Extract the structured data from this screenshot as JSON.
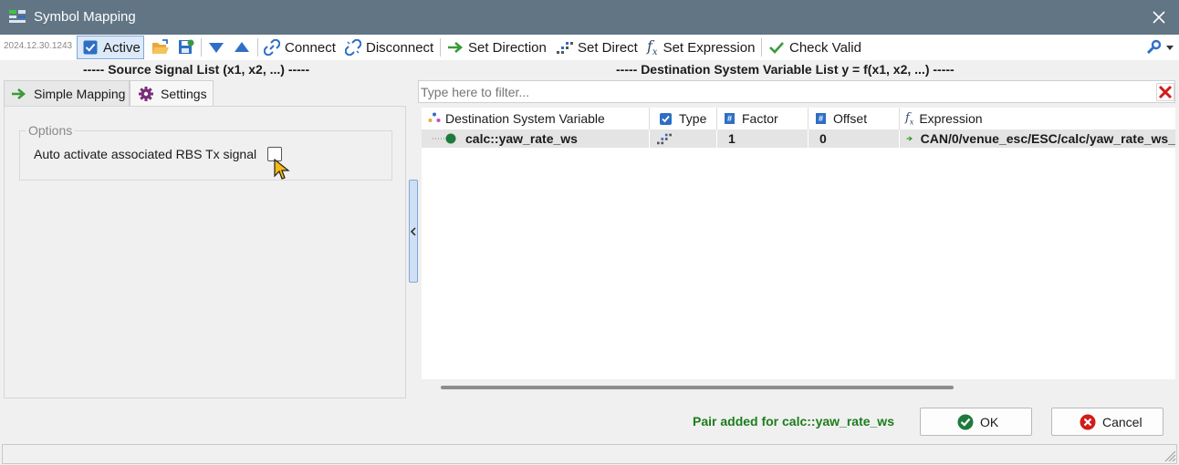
{
  "window": {
    "title": "Symbol Mapping"
  },
  "toolbar": {
    "timestamp": "2024.12.30.1243",
    "active_label": "Active",
    "connect_label": "Connect",
    "disconnect_label": "Disconnect",
    "set_direction_label": "Set Direction",
    "set_direct_label": "Set Direct",
    "set_expression_label": "Set Expression",
    "check_valid_label": "Check Valid"
  },
  "left": {
    "header": "----- Source Signal List (x1, x2, ...) -----",
    "tabs": [
      {
        "label": "Simple Mapping"
      },
      {
        "label": "Settings"
      }
    ],
    "options_group": "Options",
    "option_label": "Auto activate associated RBS Tx signal",
    "option_checked": false
  },
  "right": {
    "header": "----- Destination System Variable List y = f(x1, x2, ...) -----",
    "filter_placeholder": "Type here to filter...",
    "columns": [
      "Destination System Variable",
      "Type",
      "Factor",
      "Offset",
      "Expression"
    ],
    "rows": [
      {
        "variable": "calc::yaw_rate_ws",
        "type_icon": "direct-icon",
        "factor": "1",
        "offset": "0",
        "expression": "CAN/0/venue_esc/ESC/calc/yaw_rate_ws_"
      }
    ]
  },
  "footer": {
    "status_message": "Pair added for calc::yaw_rate_ws",
    "ok_label": "OK",
    "cancel_label": "Cancel"
  },
  "colors": {
    "titlebar": "#617585",
    "status_ok": "#1b7d1b",
    "accent": "#2e6fc4",
    "arrow_green": "#3a9a3a"
  }
}
